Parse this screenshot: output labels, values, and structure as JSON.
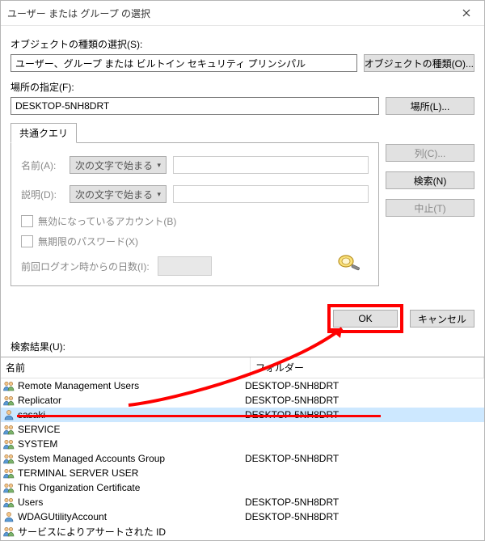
{
  "window": {
    "title": "ユーザー または グループ の選択"
  },
  "object_type": {
    "label": "オブジェクトの種類の選択(S):",
    "value": "ユーザー、グループ または ビルトイン セキュリティ プリンシパル",
    "button": "オブジェクトの種類(O)..."
  },
  "location": {
    "label": "場所の指定(F):",
    "value": "DESKTOP-5NH8DRT",
    "button": "場所(L)..."
  },
  "tab": {
    "label": "共通クエリ"
  },
  "query": {
    "name_label": "名前(A):",
    "desc_label": "説明(D):",
    "starts_with": "次の文字で始まる",
    "disabled_label": "無効になっているアカウント(B)",
    "noexpire_label": "無期限のパスワード(X)",
    "days_label": "前回ログオン時からの日数(I):"
  },
  "side_buttons": {
    "columns": "列(C)...",
    "search": "検索(N)",
    "stop": "中止(T)"
  },
  "actions": {
    "ok": "OK",
    "cancel": "キャンセル"
  },
  "results": {
    "label": "検索結果(U):",
    "col_name": "名前",
    "col_folder": "フォルダー",
    "rows": [
      {
        "icon": "group",
        "name": "Remote Management Users",
        "folder": "DESKTOP-5NH8DRT",
        "selected": false
      },
      {
        "icon": "group",
        "name": "Replicator",
        "folder": "DESKTOP-5NH8DRT",
        "selected": false
      },
      {
        "icon": "user",
        "name": "sasaki",
        "folder": "DESKTOP-5NH8DRT",
        "selected": true
      },
      {
        "icon": "group",
        "name": "SERVICE",
        "folder": "",
        "selected": false
      },
      {
        "icon": "group",
        "name": "SYSTEM",
        "folder": "",
        "selected": false
      },
      {
        "icon": "group",
        "name": "System Managed Accounts Group",
        "folder": "DESKTOP-5NH8DRT",
        "selected": false
      },
      {
        "icon": "group",
        "name": "TERMINAL SERVER USER",
        "folder": "",
        "selected": false
      },
      {
        "icon": "group",
        "name": "This Organization Certificate",
        "folder": "",
        "selected": false
      },
      {
        "icon": "group",
        "name": "Users",
        "folder": "DESKTOP-5NH8DRT",
        "selected": false
      },
      {
        "icon": "user",
        "name": "WDAGUtilityAccount",
        "folder": "DESKTOP-5NH8DRT",
        "selected": false
      },
      {
        "icon": "group",
        "name": "サービスによりアサートされた ID",
        "folder": "",
        "selected": false
      }
    ]
  }
}
